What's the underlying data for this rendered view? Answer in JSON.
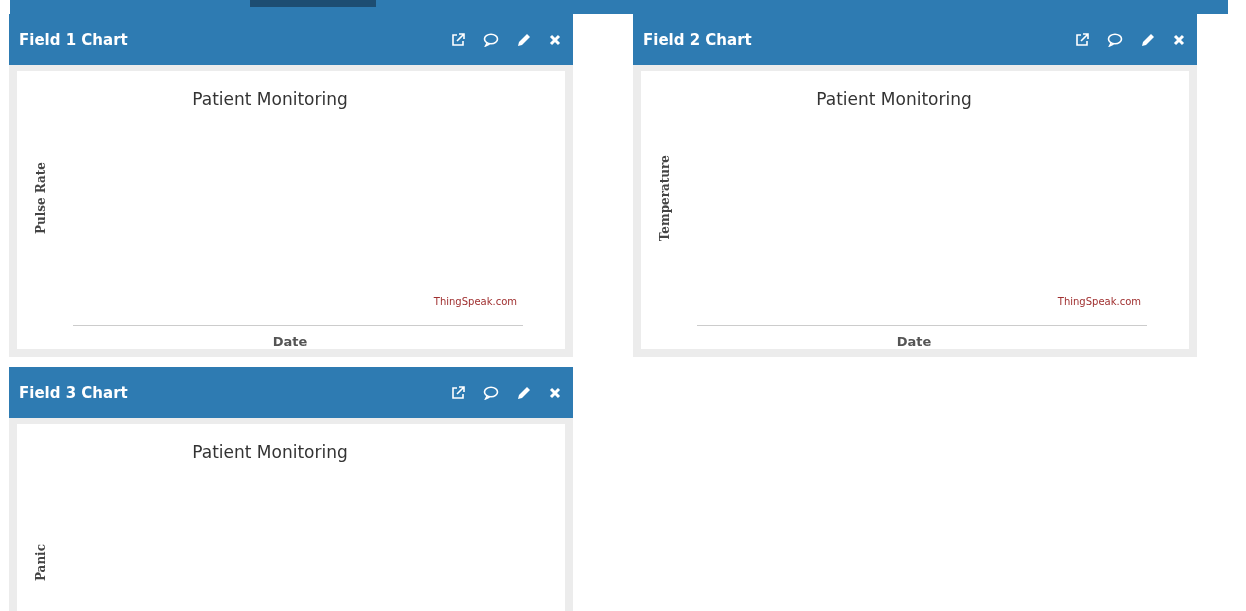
{
  "panels": [
    {
      "title": "Field 1 Chart",
      "chart": {
        "title": "Patient Monitoring",
        "ylabel": "Pulse Rate",
        "xlabel": "Date",
        "credit": "ThingSpeak.com"
      }
    },
    {
      "title": "Field 2 Chart",
      "chart": {
        "title": "Patient Monitoring",
        "ylabel": "Temperature",
        "xlabel": "Date",
        "credit": "ThingSpeak.com"
      }
    },
    {
      "title": "Field 3 Chart",
      "chart": {
        "title": "Patient Monitoring",
        "ylabel": "Panic"
      }
    }
  ]
}
